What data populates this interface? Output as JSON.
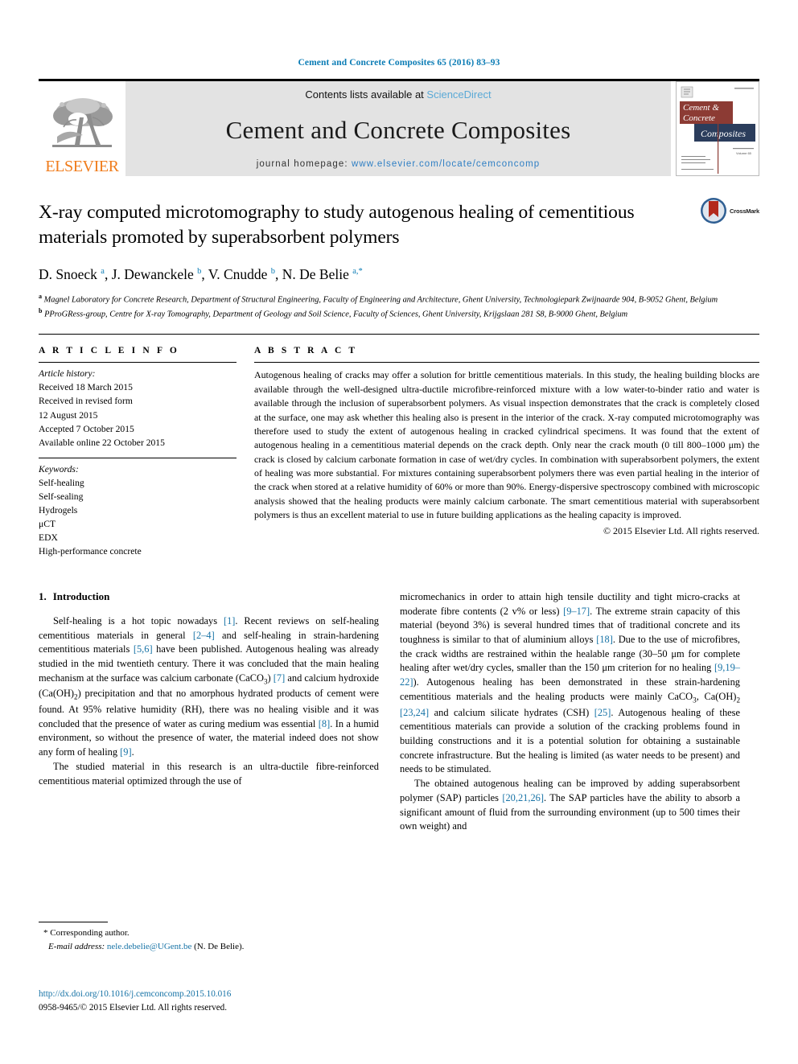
{
  "running_head": "Cement and Concrete Composites 65 (2016) 83–93",
  "masthead": {
    "publisher_logo_text": "ELSEVIER",
    "contents_prefix": "Contents lists available at ",
    "contents_link": "ScienceDirect",
    "journal_title": "Cement and Concrete Composites",
    "homepage_prefix": "journal homepage: ",
    "homepage_url": "www.elsevier.com/locate/cemconcomp",
    "cover_line1": "Cement &",
    "cover_line2": "Concrete",
    "cover_line3": "Composites",
    "brand_orange": "#f07c1b",
    "link_blue": "#2f7fc4",
    "band_gray": "#e3e3e3"
  },
  "title": "X-ray computed microtomography to study autogenous healing of cementitious materials promoted by superabsorbent polymers",
  "crossmark": {
    "label": "CrossMark"
  },
  "authors_html": "D. Snoeck <sup>a</sup>, J. Dewanckele <sup>b</sup>, V. Cnudde <sup>b</sup>, N. De Belie <sup>a,*</sup>",
  "affiliations": [
    "Magnel Laboratory for Concrete Research, Department of Structural Engineering, Faculty of Engineering and Architecture, Ghent University, Technologiepark Zwijnaarde 904, B-9052 Ghent, Belgium",
    "PProGRess-group, Centre for X-ray Tomography, Department of Geology and Soil Science, Faculty of Sciences, Ghent University, Krijgslaan 281 S8, B-9000 Ghent, Belgium"
  ],
  "article_info": {
    "heading": "A R T I C L E  I N F O",
    "history_label": "Article history:",
    "history": [
      "Received 18 March 2015",
      "Received in revised form",
      "12 August 2015",
      "Accepted 7 October 2015",
      "Available online 22 October 2015"
    ],
    "keywords_label": "Keywords:",
    "keywords": [
      "Self-healing",
      "Self-sealing",
      "Hydrogels",
      "μCT",
      "EDX",
      "High-performance concrete"
    ]
  },
  "abstract": {
    "heading": "A B S T R A C T",
    "text": "Autogenous healing of cracks may offer a solution for brittle cementitious materials. In this study, the healing building blocks are available through the well-designed ultra-ductile microfibre-reinforced mixture with a low water-to-binder ratio and water is available through the inclusion of superabsorbent polymers. As visual inspection demonstrates that the crack is completely closed at the surface, one may ask whether this healing also is present in the interior of the crack. X-ray computed microtomography was therefore used to study the extent of autogenous healing in cracked cylindrical specimens. It was found that the extent of autogenous healing in a cementitious material depends on the crack depth. Only near the crack mouth (0 till 800–1000 μm) the crack is closed by calcium carbonate formation in case of wet/dry cycles. In combination with superabsorbent polymers, the extent of healing was more substantial. For mixtures containing superabsorbent polymers there was even partial healing in the interior of the crack when stored at a relative humidity of 60% or more than 90%. Energy-dispersive spectroscopy combined with microscopic analysis showed that the healing products were mainly calcium carbonate. The smart cementitious material with superabsorbent polymers is thus an excellent material to use in future building applications as the healing capacity is improved.",
    "copyright": "© 2015 Elsevier Ltd. All rights reserved."
  },
  "intro": {
    "number": "1.",
    "heading": "Introduction",
    "left_paragraphs_html": [
      "Self-healing is a hot topic nowadays <span class=\"ref\">[1]</span>. Recent reviews on self-healing cementitious materials in general <span class=\"ref\">[2–4]</span> and self-healing in strain-hardening cementitious materials <span class=\"ref\">[5,6]</span> have been published. Autogenous healing was already studied in the mid twentieth century. There it was concluded that the main healing mechanism at the surface was calcium carbonate (CaCO<sub>3</sub>) <span class=\"ref\">[7]</span> and calcium hydroxide (Ca(OH)<sub>2</sub>) precipitation and that no amorphous hydrated products of cement were found. At 95% relative humidity (RH), there was no healing visible and it was concluded that the presence of water as curing medium was essential <span class=\"ref\">[8]</span>. In a humid environment, so without the presence of water, the material indeed does not show any form of healing <span class=\"ref\">[9]</span>.",
      "The studied material in this research is an ultra-ductile fibre-reinforced cementitious material optimized through the use of"
    ],
    "right_paragraphs_html": [
      "micromechanics in order to attain high tensile ductility and tight micro-cracks at moderate fibre contents (2 v% or less) <span class=\"ref\">[9–17]</span>. The extreme strain capacity of this material (beyond 3%) is several hundred times that of traditional concrete and its toughness is similar to that of aluminium alloys <span class=\"ref\">[18]</span>. Due to the use of microfibres, the crack widths are restrained within the healable range (30–50 μm for complete healing after wet/dry cycles, smaller than the 150 μm criterion for no healing <span class=\"ref\">[9,19–22]</span>). Autogenous healing has been demonstrated in these strain-hardening cementitious materials and the healing products were mainly CaCO<sub>3</sub>, Ca(OH)<sub>2</sub> <span class=\"ref\">[23,24]</span> and calcium silicate hydrates (CSH) <span class=\"ref\">[25]</span>. Autogenous healing of these cementitious materials can provide a solution of the cracking problems found in building constructions and it is a potential solution for obtaining a sustainable concrete infrastructure. But the healing is limited (as water needs to be present) and needs to be stimulated.",
      "The obtained autogenous healing can be improved by adding superabsorbent polymer (SAP) particles <span class=\"ref\">[20,21,26]</span>. The SAP particles have the ability to absorb a significant amount of fluid from the surrounding environment (up to 500 times their own weight) and"
    ]
  },
  "footnote": {
    "corresponding": "Corresponding author.",
    "email_label": "E-mail address:",
    "email": "nele.debelie@UGent.be",
    "email_suffix": "(N. De Belie)."
  },
  "doi": {
    "url": "http://dx.doi.org/10.1016/j.cemconcomp.2015.10.016",
    "issn_line": "0958-9465/© 2015 Elsevier Ltd. All rights reserved."
  }
}
